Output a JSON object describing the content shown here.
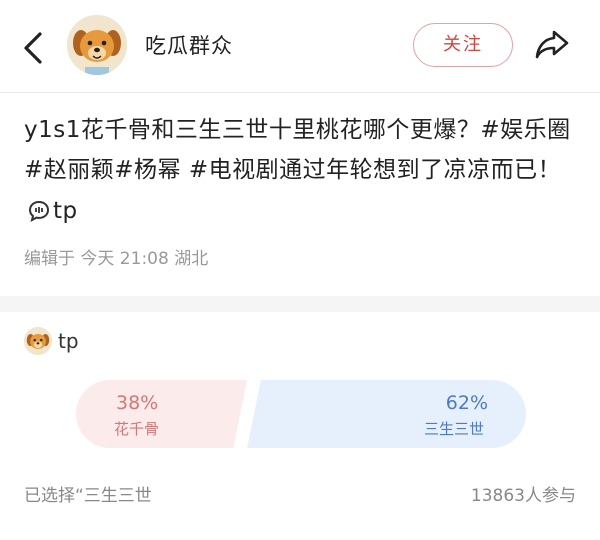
{
  "header": {
    "author_name": "吃瓜群众",
    "follow_label": "关注"
  },
  "post": {
    "text": "y1s1花千骨和三生三世十里桃花哪个更爆？#娱乐圈#赵丽颖#杨幂 #电视剧通过年轮想到了凉凉而已！",
    "inline_link": "tp",
    "meta": "编辑于 今天 21:08 湖北"
  },
  "poll": {
    "author": "tp",
    "option_a": {
      "percent": "38%",
      "label": "花千骨",
      "share": 0.38
    },
    "option_b": {
      "percent": "62%",
      "label": "三生三世",
      "share": 0.62
    },
    "selected": "已选择“三生三世",
    "participants": "13863人参与"
  },
  "colors": {
    "follow": "#d2463e",
    "option_a": "#d47777",
    "option_b": "#4d7ac5"
  }
}
